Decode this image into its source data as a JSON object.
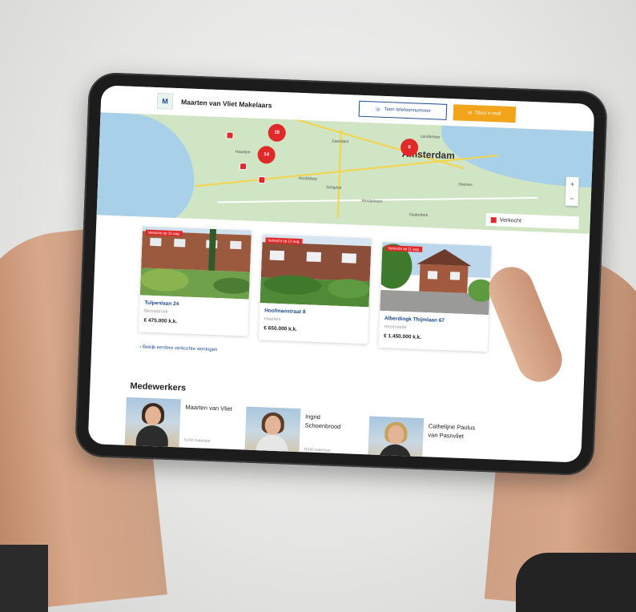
{
  "header": {
    "logo_letter": "M",
    "brand": "Maarten van Vliet Makelaars",
    "phone_button": "Toon telefoonnummer",
    "mail_button": "Stuur e-mail"
  },
  "map": {
    "city_main": "Amsterdam",
    "clusters": [
      "16",
      "14",
      "6"
    ],
    "legend": "Verkocht",
    "zoom_in": "+",
    "zoom_out": "−",
    "cities": [
      "Haarlem",
      "Zaandam",
      "Amstelveen",
      "Hoofddorp",
      "Schiphol",
      "Diemen",
      "Landsmeer",
      "Ouderkerk"
    ]
  },
  "listings": [
    {
      "tag": "Verkocht op 15 aug.",
      "street": "Tulpenlaan 24",
      "city": "Bennebroek",
      "price": "€ 475.000 k.k."
    },
    {
      "tag": "Verkocht op 12 aug.",
      "street": "Hoofmanstraat 8",
      "city": "Haarlem",
      "price": "€ 650.000 k.k."
    },
    {
      "tag": "Verkocht op 11 aug.",
      "street": "Alberdingk Thijmlaan 67",
      "city": "Heemstede",
      "price": "€ 1.450.000 k.k."
    }
  ],
  "more_link": "Bekijk eerdere verkochte woningen",
  "team": {
    "heading": "Medewerkers",
    "members": [
      {
        "name": "Maarten van Vliet",
        "role": "NVM makelaar"
      },
      {
        "name": "Ingrid Schoenbrood",
        "role": "NVM makelaar"
      },
      {
        "name": "Cathelijne Paulus van Pasnvliet",
        "role": ""
      }
    ]
  },
  "colors": {
    "brand_blue": "#1c4b8f",
    "accent_orange": "#f2a41a",
    "sold_red": "#e02a2a"
  }
}
